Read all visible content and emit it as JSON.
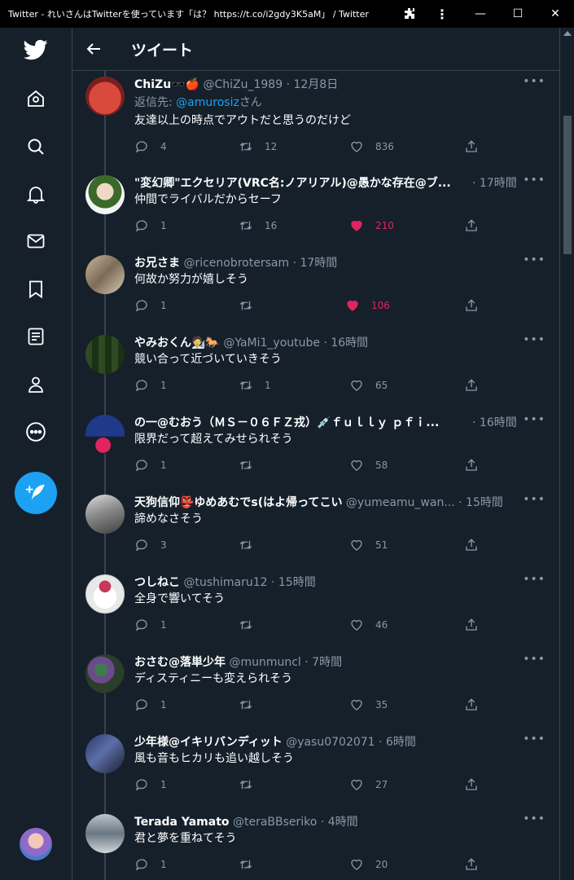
{
  "window": {
    "title": "Twitter - れいさんはTwitterを使っています「は？ https://t.co/i2gdy3K5aM」 / Twitter",
    "controls": [
      "—",
      "☐",
      "✕"
    ]
  },
  "nav": {
    "items": [
      "twitter-logo-icon",
      "home-icon",
      "search-icon",
      "notifications-icon",
      "messages-icon",
      "bookmarks-icon",
      "lists-icon",
      "profile-icon",
      "more-icon"
    ],
    "accent": "#1da1f2"
  },
  "header": {
    "title": "ツイート"
  },
  "tweets": [
    {
      "name": "ChiZu🕶️🍎",
      "handle": "@ChiZu_1989",
      "time": "12月8日",
      "reply_prefix": "返信先: ",
      "reply_link": "@amurosiz",
      "reply_suffix": "さん",
      "text": "友達以上の時点でアウトだと思うのだけど",
      "reply": "4",
      "retweet": "12",
      "like": "836",
      "liked": false
    },
    {
      "name": "\"変幻卿\"エクセリア(VRC名:ノアリアル)@愚かな存在@ブ...",
      "handle": "",
      "time": "17時間",
      "text": "仲間でライバルだからセーフ",
      "reply": "1",
      "retweet": "16",
      "like": "210",
      "liked": true
    },
    {
      "name": "お兄さま",
      "handle": "@ricenobrotersam",
      "time": "17時間",
      "text": "何故か努力が嬉しそう",
      "reply": "1",
      "retweet": "",
      "like": "106",
      "liked": true
    },
    {
      "name": "やみおくん🧑‍🔬🐎",
      "handle": "@YaMi1_youtube",
      "time": "16時間",
      "text": "競い合って近づいていきそう",
      "reply": "1",
      "retweet": "1",
      "like": "65",
      "liked": false
    },
    {
      "name": "の一@むおう（ＭＳ－０６ＦＺ戎）💉ｆｕｌｌｙ ｐｆｉ...",
      "handle": "",
      "time": "16時間",
      "text": "限界だって超えてみせられそう",
      "reply": "1",
      "retweet": "",
      "like": "58",
      "liked": false
    },
    {
      "name": "天狗信仰👺ゆめあむでs(はよ帰ってこい",
      "handle": "@yumeamu_wan...",
      "time": "15時間",
      "text": "諦めなさそう",
      "reply": "3",
      "retweet": "",
      "like": "51",
      "liked": false
    },
    {
      "name": "つしねこ",
      "handle": "@tushimaru12",
      "time": "15時間",
      "text": "全身で響いてそう",
      "reply": "1",
      "retweet": "",
      "like": "46",
      "liked": false
    },
    {
      "name": "おさむ@落単少年",
      "handle": "@munmuncl",
      "time": "7時間",
      "text": "ディスティニーも変えられそう",
      "reply": "1",
      "retweet": "",
      "like": "35",
      "liked": false
    },
    {
      "name": "少年様@イキリバンディット",
      "handle": "@yasu0702071",
      "time": "6時間",
      "text": "風も音もヒカリも追い越しそう",
      "reply": "1",
      "retweet": "",
      "like": "27",
      "liked": false
    },
    {
      "name": "Terada Yamato",
      "handle": "@teraBBseriko",
      "time": "4時間",
      "text": "君と夢を重ねてそう",
      "reply": "1",
      "retweet": "",
      "like": "20",
      "liked": false
    }
  ]
}
